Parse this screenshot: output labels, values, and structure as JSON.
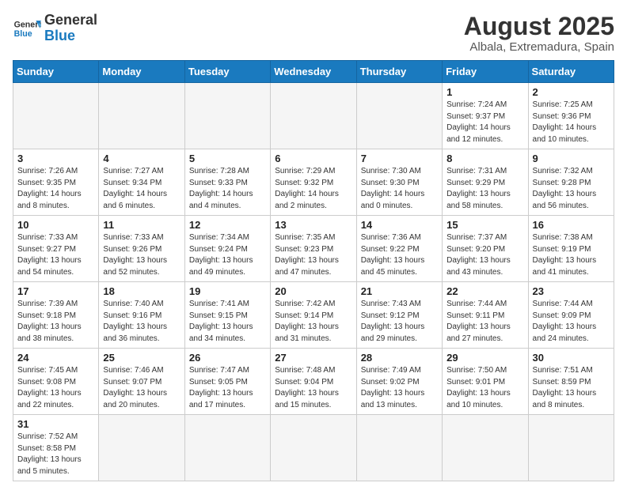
{
  "header": {
    "logo_general": "General",
    "logo_blue": "Blue",
    "month_year": "August 2025",
    "location": "Albala, Extremadura, Spain"
  },
  "weekdays": [
    "Sunday",
    "Monday",
    "Tuesday",
    "Wednesday",
    "Thursday",
    "Friday",
    "Saturday"
  ],
  "weeks": [
    [
      {
        "day": "",
        "info": ""
      },
      {
        "day": "",
        "info": ""
      },
      {
        "day": "",
        "info": ""
      },
      {
        "day": "",
        "info": ""
      },
      {
        "day": "",
        "info": ""
      },
      {
        "day": "1",
        "info": "Sunrise: 7:24 AM\nSunset: 9:37 PM\nDaylight: 14 hours and 12 minutes."
      },
      {
        "day": "2",
        "info": "Sunrise: 7:25 AM\nSunset: 9:36 PM\nDaylight: 14 hours and 10 minutes."
      }
    ],
    [
      {
        "day": "3",
        "info": "Sunrise: 7:26 AM\nSunset: 9:35 PM\nDaylight: 14 hours and 8 minutes."
      },
      {
        "day": "4",
        "info": "Sunrise: 7:27 AM\nSunset: 9:34 PM\nDaylight: 14 hours and 6 minutes."
      },
      {
        "day": "5",
        "info": "Sunrise: 7:28 AM\nSunset: 9:33 PM\nDaylight: 14 hours and 4 minutes."
      },
      {
        "day": "6",
        "info": "Sunrise: 7:29 AM\nSunset: 9:32 PM\nDaylight: 14 hours and 2 minutes."
      },
      {
        "day": "7",
        "info": "Sunrise: 7:30 AM\nSunset: 9:30 PM\nDaylight: 14 hours and 0 minutes."
      },
      {
        "day": "8",
        "info": "Sunrise: 7:31 AM\nSunset: 9:29 PM\nDaylight: 13 hours and 58 minutes."
      },
      {
        "day": "9",
        "info": "Sunrise: 7:32 AM\nSunset: 9:28 PM\nDaylight: 13 hours and 56 minutes."
      }
    ],
    [
      {
        "day": "10",
        "info": "Sunrise: 7:33 AM\nSunset: 9:27 PM\nDaylight: 13 hours and 54 minutes."
      },
      {
        "day": "11",
        "info": "Sunrise: 7:33 AM\nSunset: 9:26 PM\nDaylight: 13 hours and 52 minutes."
      },
      {
        "day": "12",
        "info": "Sunrise: 7:34 AM\nSunset: 9:24 PM\nDaylight: 13 hours and 49 minutes."
      },
      {
        "day": "13",
        "info": "Sunrise: 7:35 AM\nSunset: 9:23 PM\nDaylight: 13 hours and 47 minutes."
      },
      {
        "day": "14",
        "info": "Sunrise: 7:36 AM\nSunset: 9:22 PM\nDaylight: 13 hours and 45 minutes."
      },
      {
        "day": "15",
        "info": "Sunrise: 7:37 AM\nSunset: 9:20 PM\nDaylight: 13 hours and 43 minutes."
      },
      {
        "day": "16",
        "info": "Sunrise: 7:38 AM\nSunset: 9:19 PM\nDaylight: 13 hours and 41 minutes."
      }
    ],
    [
      {
        "day": "17",
        "info": "Sunrise: 7:39 AM\nSunset: 9:18 PM\nDaylight: 13 hours and 38 minutes."
      },
      {
        "day": "18",
        "info": "Sunrise: 7:40 AM\nSunset: 9:16 PM\nDaylight: 13 hours and 36 minutes."
      },
      {
        "day": "19",
        "info": "Sunrise: 7:41 AM\nSunset: 9:15 PM\nDaylight: 13 hours and 34 minutes."
      },
      {
        "day": "20",
        "info": "Sunrise: 7:42 AM\nSunset: 9:14 PM\nDaylight: 13 hours and 31 minutes."
      },
      {
        "day": "21",
        "info": "Sunrise: 7:43 AM\nSunset: 9:12 PM\nDaylight: 13 hours and 29 minutes."
      },
      {
        "day": "22",
        "info": "Sunrise: 7:44 AM\nSunset: 9:11 PM\nDaylight: 13 hours and 27 minutes."
      },
      {
        "day": "23",
        "info": "Sunrise: 7:44 AM\nSunset: 9:09 PM\nDaylight: 13 hours and 24 minutes."
      }
    ],
    [
      {
        "day": "24",
        "info": "Sunrise: 7:45 AM\nSunset: 9:08 PM\nDaylight: 13 hours and 22 minutes."
      },
      {
        "day": "25",
        "info": "Sunrise: 7:46 AM\nSunset: 9:07 PM\nDaylight: 13 hours and 20 minutes."
      },
      {
        "day": "26",
        "info": "Sunrise: 7:47 AM\nSunset: 9:05 PM\nDaylight: 13 hours and 17 minutes."
      },
      {
        "day": "27",
        "info": "Sunrise: 7:48 AM\nSunset: 9:04 PM\nDaylight: 13 hours and 15 minutes."
      },
      {
        "day": "28",
        "info": "Sunrise: 7:49 AM\nSunset: 9:02 PM\nDaylight: 13 hours and 13 minutes."
      },
      {
        "day": "29",
        "info": "Sunrise: 7:50 AM\nSunset: 9:01 PM\nDaylight: 13 hours and 10 minutes."
      },
      {
        "day": "30",
        "info": "Sunrise: 7:51 AM\nSunset: 8:59 PM\nDaylight: 13 hours and 8 minutes."
      }
    ],
    [
      {
        "day": "31",
        "info": "Sunrise: 7:52 AM\nSunset: 8:58 PM\nDaylight: 13 hours and 5 minutes."
      },
      {
        "day": "",
        "info": ""
      },
      {
        "day": "",
        "info": ""
      },
      {
        "day": "",
        "info": ""
      },
      {
        "day": "",
        "info": ""
      },
      {
        "day": "",
        "info": ""
      },
      {
        "day": "",
        "info": ""
      }
    ]
  ]
}
